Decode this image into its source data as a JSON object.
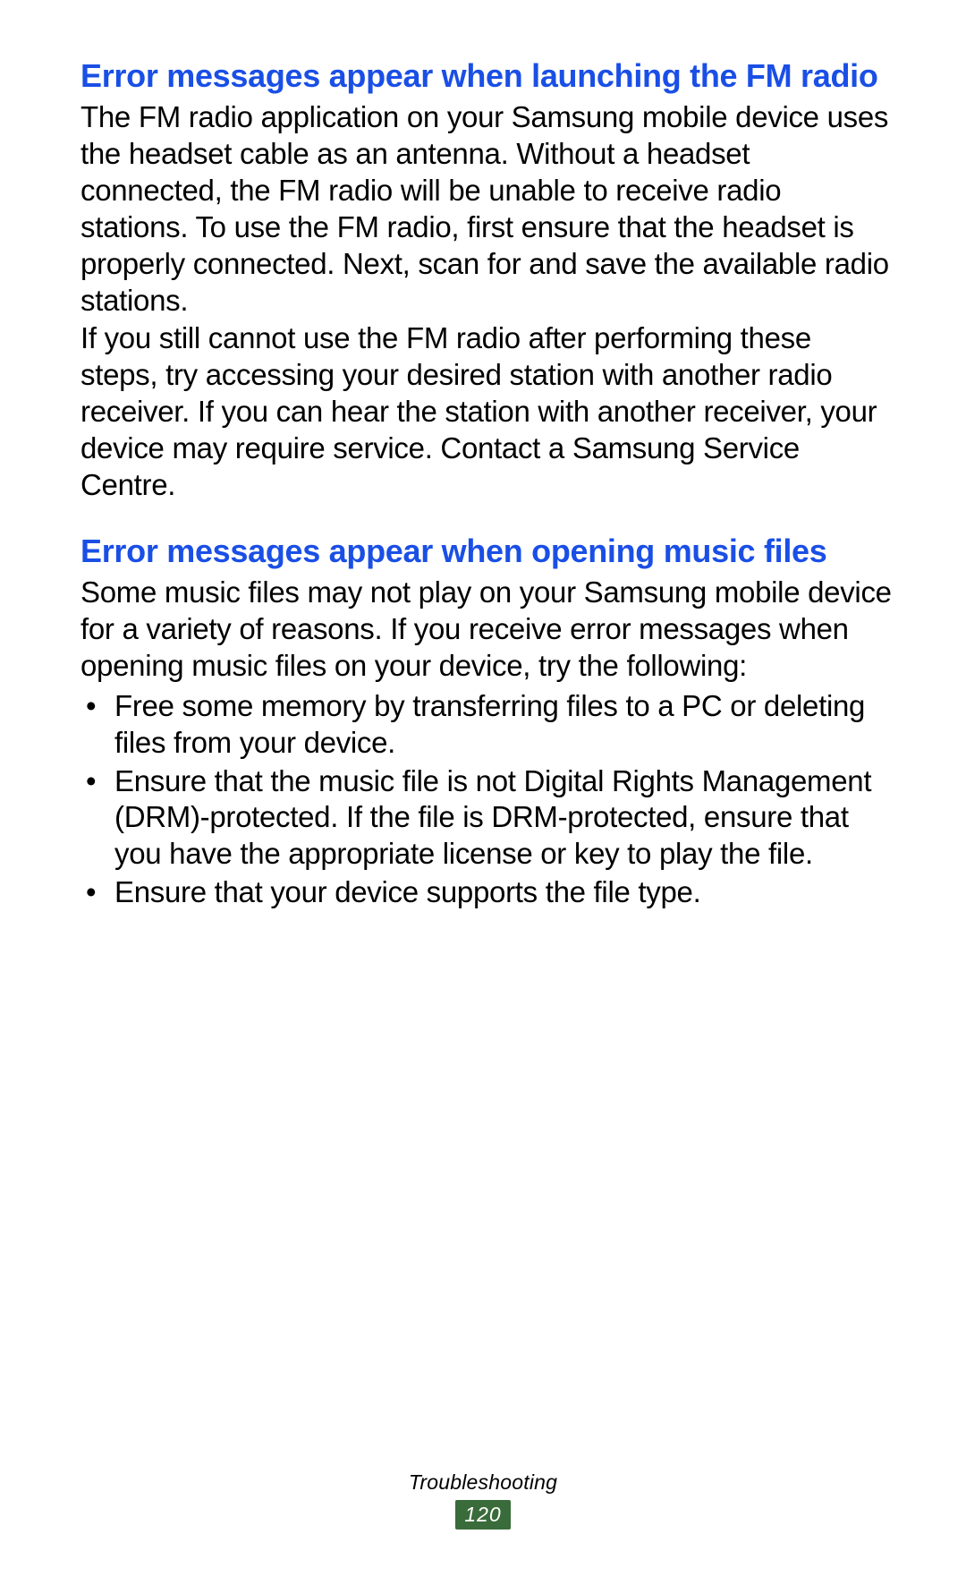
{
  "sections": [
    {
      "heading": "Error messages appear when launching the FM radio",
      "paragraphs": [
        "The FM radio application on your Samsung mobile device uses the headset cable as an antenna. Without a headset connected, the FM radio will be unable to receive radio stations. To use the FM radio, first ensure that the headset is properly connected. Next, scan for and save the available radio stations.",
        "If you still cannot use the FM radio after performing these steps, try accessing your desired station with another radio receiver. If you can hear the station with another receiver, your device may require service. Contact a Samsung Service Centre."
      ],
      "bullets": []
    },
    {
      "heading": "Error messages appear when opening music files",
      "paragraphs": [
        "Some music files may not play on your Samsung mobile device for a variety of reasons. If you receive error messages when opening music files on your device, try the following:"
      ],
      "bullets": [
        "Free some memory by transferring files to a PC or deleting files from your device.",
        "Ensure that the music file is not Digital Rights Management (DRM)-protected. If the file is DRM-protected, ensure that you have the appropriate license or key to play the file.",
        "Ensure that your device supports the file type."
      ]
    }
  ],
  "footer": {
    "section_label": "Troubleshooting",
    "page_number": "120"
  }
}
